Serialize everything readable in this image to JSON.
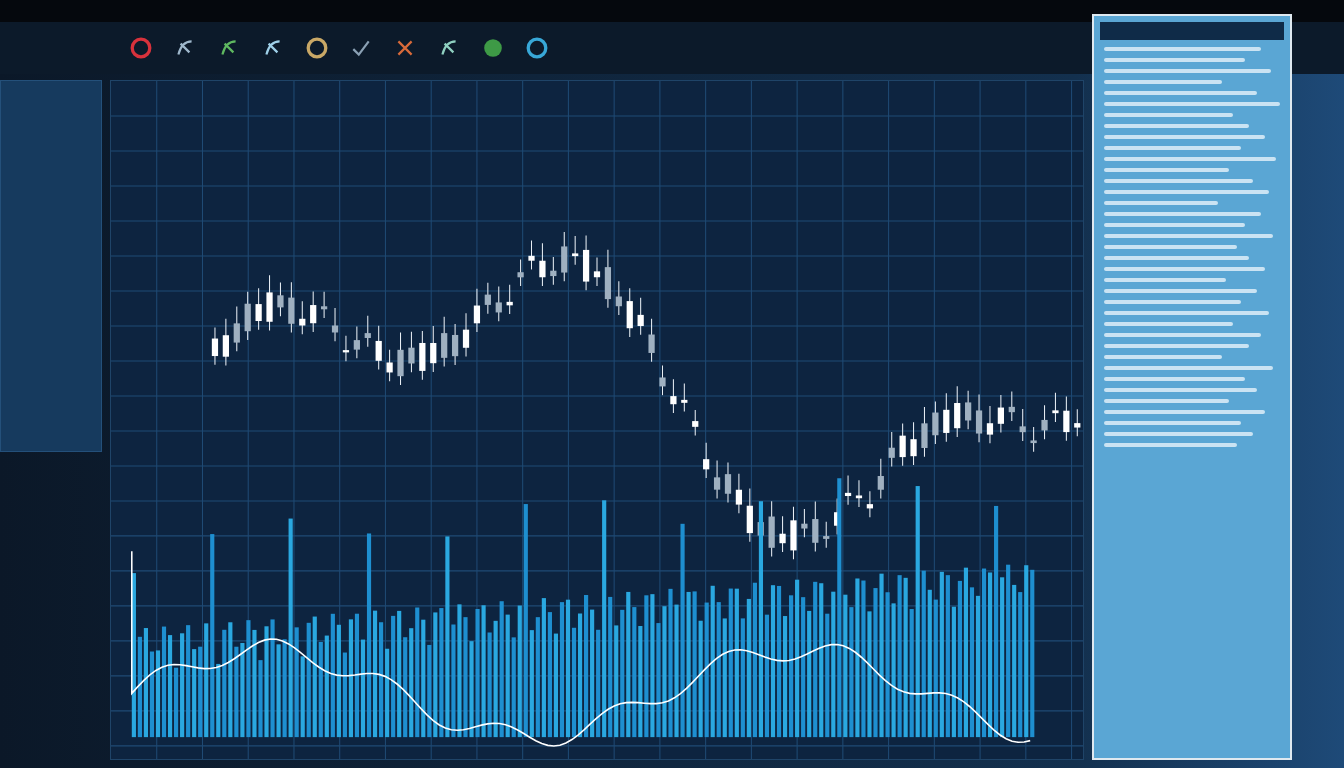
{
  "toolbar": {
    "icons": [
      {
        "kind": "ring",
        "color": "#d8323c"
      },
      {
        "kind": "glyph",
        "color": "#9fb8cc"
      },
      {
        "kind": "glyph",
        "color": "#5fb860"
      },
      {
        "kind": "glyph",
        "color": "#9fd0e8"
      },
      {
        "kind": "ring",
        "color": "#c9a866"
      },
      {
        "kind": "check",
        "color": "#8aa0b4"
      },
      {
        "kind": "cross",
        "color": "#d86a3a"
      },
      {
        "kind": "glyph",
        "color": "#8fd0c0"
      },
      {
        "kind": "dot",
        "color": "#3e9a46"
      },
      {
        "kind": "ring",
        "color": "#38a8d8"
      }
    ]
  }
}
